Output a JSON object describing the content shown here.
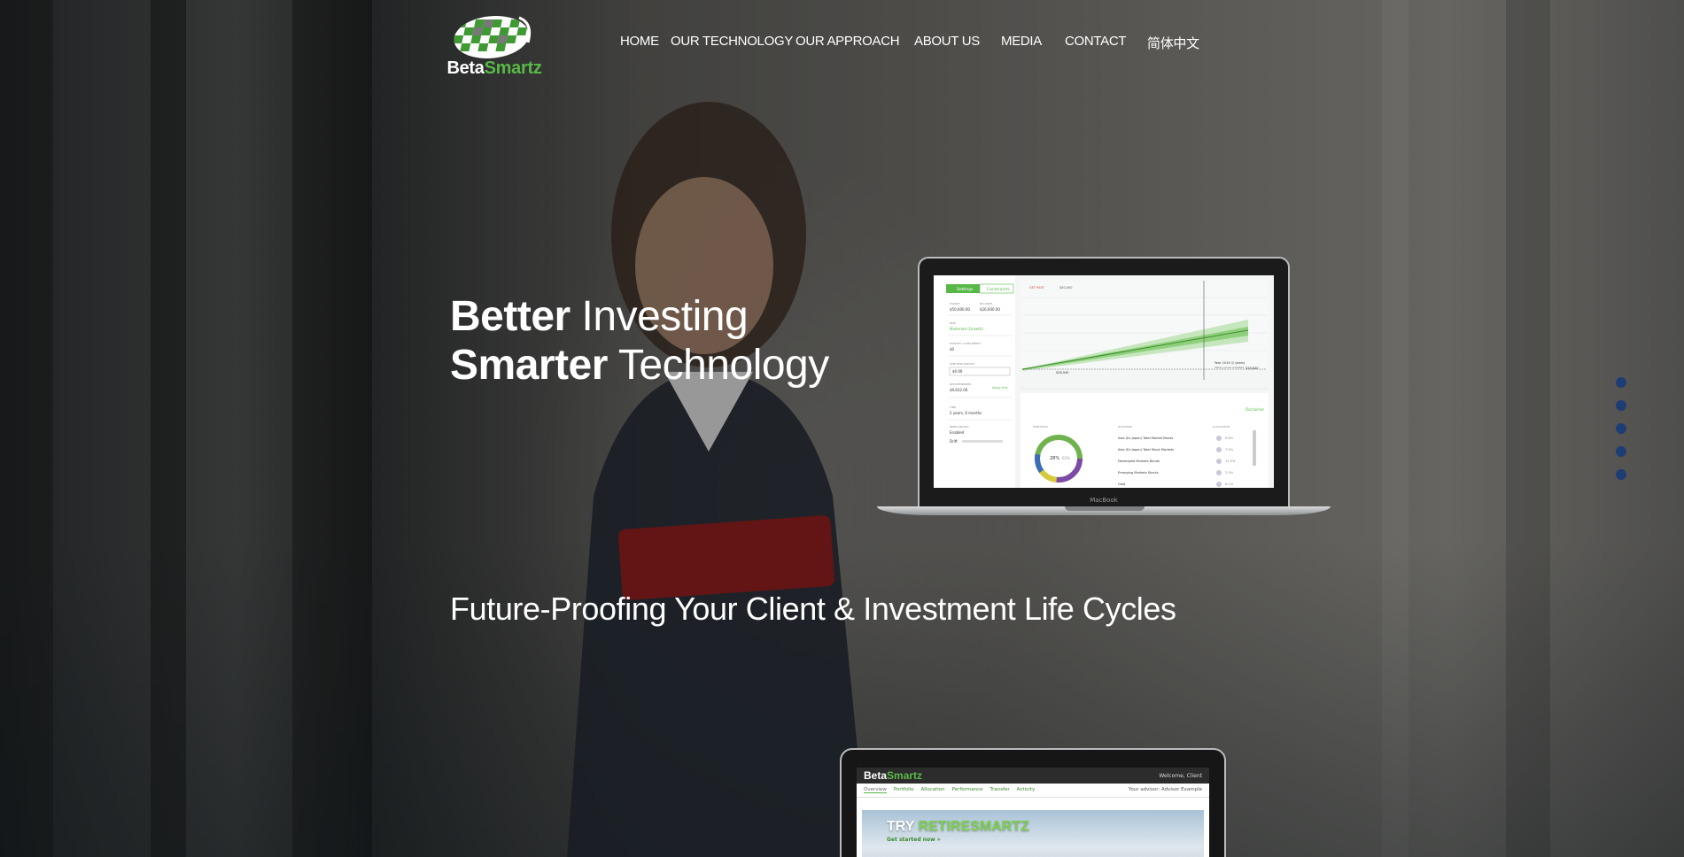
{
  "header": {
    "logo": {
      "prefix": "Beta",
      "suffix": "Smartz"
    },
    "nav": [
      {
        "label": "HOME"
      },
      {
        "label": "OUR TECHNOLOGY"
      },
      {
        "label": "OUR APPROACH"
      },
      {
        "label": "ABOUT US"
      },
      {
        "label": "MEDIA"
      },
      {
        "label": "CONTACT"
      },
      {
        "label": "简体中文"
      }
    ]
  },
  "hero": {
    "line1_strong": "Better",
    "line1_rest": " Investing",
    "line2_strong": "Smarter",
    "line2_rest": " Technology",
    "subheadline": "Future-Proofing Your Client & Investment Life Cycles"
  },
  "laptop": {
    "brand": "MacBook",
    "tabs": [
      "Settings",
      "Constraints"
    ],
    "target_label": "TARGET",
    "target_value": "$50,000.00",
    "balance_label": "BALANCE",
    "balance_value": "$26,940.00",
    "risk_label": "RISK",
    "risk_value": "Moderate (Growth)",
    "monthly_label": "MONTHLY SUPPLEMENT",
    "monthly_value": "$0",
    "one_time_label": "ONE-TIME DEPOSIT",
    "one_time_value": "$0.00",
    "recommended_label": "RECOMMENDED",
    "recommended_value": "$9,632.00",
    "apply_label": "Apply this",
    "time_label": "TIME",
    "time_value": "2 years, 6 months",
    "rebalancing_label": "REBALANCING",
    "rebalancing_value": "Enabled",
    "drift_label": "Drift",
    "goal_hint": "GET PAST",
    "goal_value": "$50,000",
    "year_note": "Year 2019 (2 years)",
    "year_note2": "Value you've invested",
    "end_value": "$26,840",
    "start_value": "$26,940",
    "disclaimer": "Disclaimer",
    "portfolio_label": "PORTFOLIO",
    "donut_center": "28%",
    "donut_side": "62%",
    "holdings_label": "HOLDINGS",
    "allocation_label": "ALLOCATION",
    "holdings": [
      {
        "name": "Asia (Ex Japan) Total Market Bonds",
        "pct": "9.6%"
      },
      {
        "name": "Asia (Ex Japan) Total Stock Markets",
        "pct": "7.5%"
      },
      {
        "name": "Developed Markets Bonds",
        "pct": "12.5%"
      },
      {
        "name": "Emerging Markets Stocks",
        "pct": "2.5%"
      },
      {
        "name": "Gold",
        "pct": "6.1%"
      }
    ]
  },
  "tablet": {
    "brand_prefix": "Beta",
    "brand_suffix": "Smartz",
    "welcome": "Welcome, Client",
    "tabs": [
      "Overview",
      "Portfolio",
      "Allocation",
      "Performance",
      "Transfer",
      "Activity"
    ],
    "advisor": "Your advisor: Advisor Example",
    "banner_try": "TRY ",
    "banner_product": "RETIRESMARTZ",
    "banner_cta": "Get started now »"
  },
  "pager": {
    "count": 5
  },
  "colors": {
    "accent": "#58b847",
    "dot": "#1f3d75"
  }
}
